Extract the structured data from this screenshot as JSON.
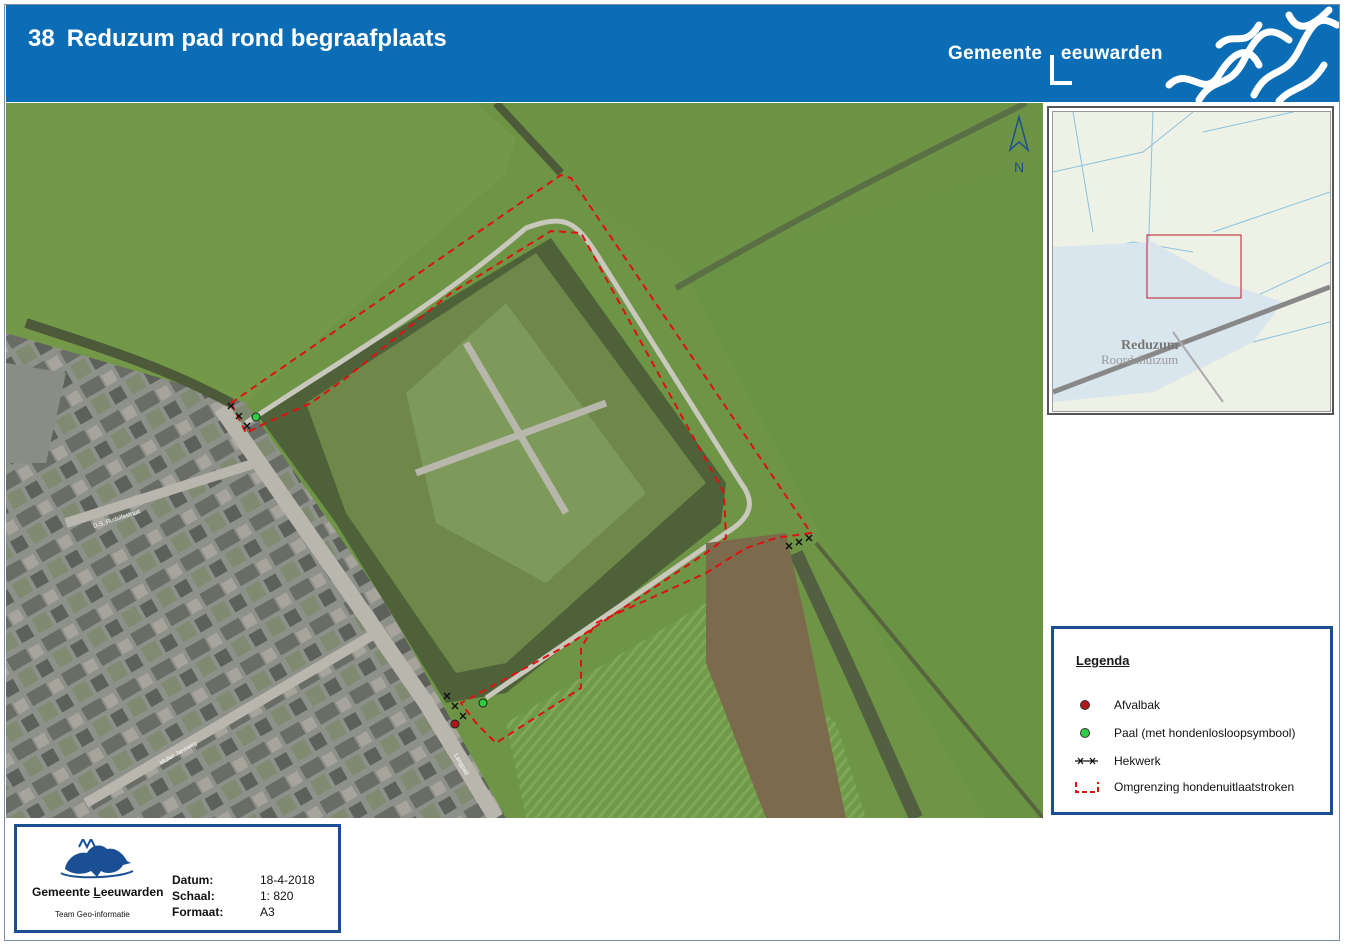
{
  "header": {
    "number": "38",
    "title": "Reduzum pad rond begraafplaats",
    "brand": "Gemeente ",
    "brand_l": "L",
    "brand_rest": "eeuwarden"
  },
  "map": {
    "north_label": "N",
    "street_labels": [
      "D.S. Rudolfastraat",
      "Mulier Jansweg",
      "Langpad"
    ]
  },
  "overview": {
    "place": "Reduzum",
    "place_alt": "Roordahuizum"
  },
  "legend": {
    "title": "Legenda",
    "items": [
      {
        "label": "Afvalbak",
        "symbol": "red-dot"
      },
      {
        "label": "Paal (met hondenlosloopsymbool)",
        "symbol": "green-dot"
      },
      {
        "label": "Hekwerk",
        "symbol": "fence"
      },
      {
        "label": "Omgrenzing hondenuitlaatstroken",
        "symbol": "red-dashed-line"
      }
    ]
  },
  "footer": {
    "logo_text": "Gemeente ",
    "logo_l": "L",
    "logo_rest": "eeuwarden",
    "logo_sub": "Team Geo-informatie",
    "datum_label": "Datum:",
    "datum": "18-4-2018",
    "schaal_label": "Schaal:",
    "schaal": "1: 820",
    "formaat_label": "Formaat:",
    "formaat": "A3"
  },
  "colors": {
    "header_bg": "#0a6db5",
    "boundary": "#e01010",
    "afvalbak": "#b01818",
    "paal": "#2ecc40",
    "legend_border": "#1a4f94"
  }
}
